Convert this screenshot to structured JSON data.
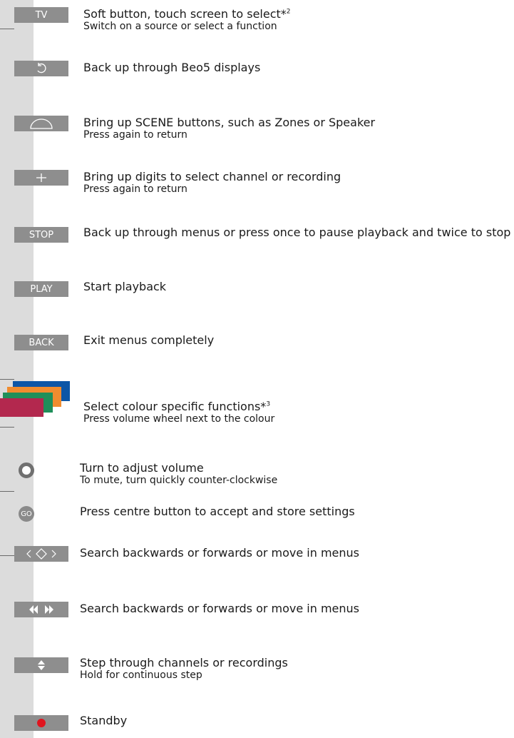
{
  "colors": {
    "strip": "#dcdcdc",
    "button_fill": "#8e8e8e",
    "blue": "#0d56a6",
    "orange": "#f08c2f",
    "green": "#1f8f5a",
    "red": "#b3284e",
    "standby_dot": "#e0141e"
  },
  "items": [
    {
      "button_label": "TV",
      "title": "Soft button, touch screen to select*",
      "note": "2",
      "subtitle": "Switch on a source or select a function"
    },
    {
      "button_icon": "back-arrow-icon",
      "title": "Back up through Beo5 displays"
    },
    {
      "button_icon": "scene-dome-icon",
      "title": "Bring up SCENE buttons, such as Zones or Speaker",
      "subtitle": "Press again to return"
    },
    {
      "button_icon": "plus-icon",
      "title": "Bring up digits to select channel or recording",
      "subtitle": "Press again to return"
    },
    {
      "button_label": "STOP",
      "title": "Back up through menus or press once to pause playback and twice to stop"
    },
    {
      "button_label": "PLAY",
      "title": "Start playback"
    },
    {
      "button_label": "BACK",
      "title": "Exit menus completely"
    },
    {
      "button_icon": "colour-buttons-icon",
      "title": "Select colour specific functions*",
      "note": "3",
      "subtitle": "Press volume wheel next to the colour"
    },
    {
      "button_icon": "volume-wheel-icon",
      "title": "Turn to adjust volume",
      "subtitle": "To mute, turn quickly counter-clockwise"
    },
    {
      "button_label": "GO",
      "title": "Press centre button to accept and store settings"
    },
    {
      "button_icon": "navigation-arrows-icon",
      "title": "Search backwards or forwards or move in menus"
    },
    {
      "button_icon": "wind-rewind-icon",
      "title": "Search backwards or forwards or move in menus"
    },
    {
      "button_icon": "up-down-step-icon",
      "title": "Step through channels or recordings",
      "subtitle": "Hold for continuous step"
    },
    {
      "button_icon": "standby-icon",
      "title": "Standby"
    }
  ]
}
